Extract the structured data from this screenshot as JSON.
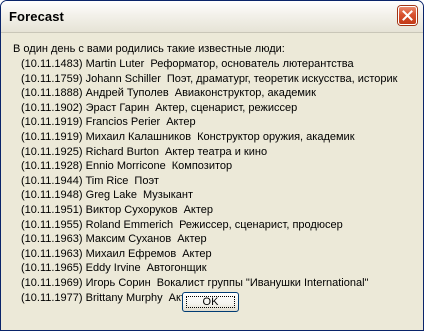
{
  "window": {
    "title": "Forecast"
  },
  "icons": {
    "close": "close-icon"
  },
  "intro": "В один день с вами родились такие известные люди:",
  "people": [
    {
      "date": "(10.11.1483)",
      "name": "Martin Luter",
      "desc": "Реформатор, основатель лютерантства"
    },
    {
      "date": "(10.11.1759)",
      "name": "Johann Schiller",
      "desc": "Поэт, драматург, теоретик искусства, историк"
    },
    {
      "date": "(10.11.1888)",
      "name": "Андрей Туполев",
      "desc": "Авиаконструктор, академик"
    },
    {
      "date": "(10.11.1902)",
      "name": "Эраст Гарин",
      "desc": "Актер, сценарист, режиссер"
    },
    {
      "date": "(10.11.1919)",
      "name": "Francios Perier",
      "desc": "Актер"
    },
    {
      "date": "(10.11.1919)",
      "name": "Михаил Калашников",
      "desc": "Конструктор оружия, академик"
    },
    {
      "date": "(10.11.1925)",
      "name": "Richard Burton",
      "desc": "Актер театра и кино"
    },
    {
      "date": "(10.11.1928)",
      "name": "Ennio Morricone",
      "desc": "Композитор"
    },
    {
      "date": "(10.11.1944)",
      "name": "Tim Rice",
      "desc": "Поэт"
    },
    {
      "date": "(10.11.1948)",
      "name": "Greg Lake",
      "desc": "Музыкант"
    },
    {
      "date": "(10.11.1951)",
      "name": "Виктор Сухоруков",
      "desc": "Актер"
    },
    {
      "date": "(10.11.1955)",
      "name": "Roland Emmerich",
      "desc": "Режиссер, сценарист, продюсер"
    },
    {
      "date": "(10.11.1963)",
      "name": "Максим Суханов",
      "desc": "Актер"
    },
    {
      "date": "(10.11.1963)",
      "name": "Михаил Ефремов",
      "desc": "Актер"
    },
    {
      "date": "(10.11.1965)",
      "name": "Eddy Irvine",
      "desc": "Автогонщик"
    },
    {
      "date": "(10.11.1969)",
      "name": "Игорь Сорин",
      "desc": "Вокалист группы \"Иванушки International\""
    },
    {
      "date": "(10.11.1977)",
      "name": "Brittany Murphy",
      "desc": "Актриса"
    }
  ],
  "buttons": {
    "ok": "OK"
  }
}
